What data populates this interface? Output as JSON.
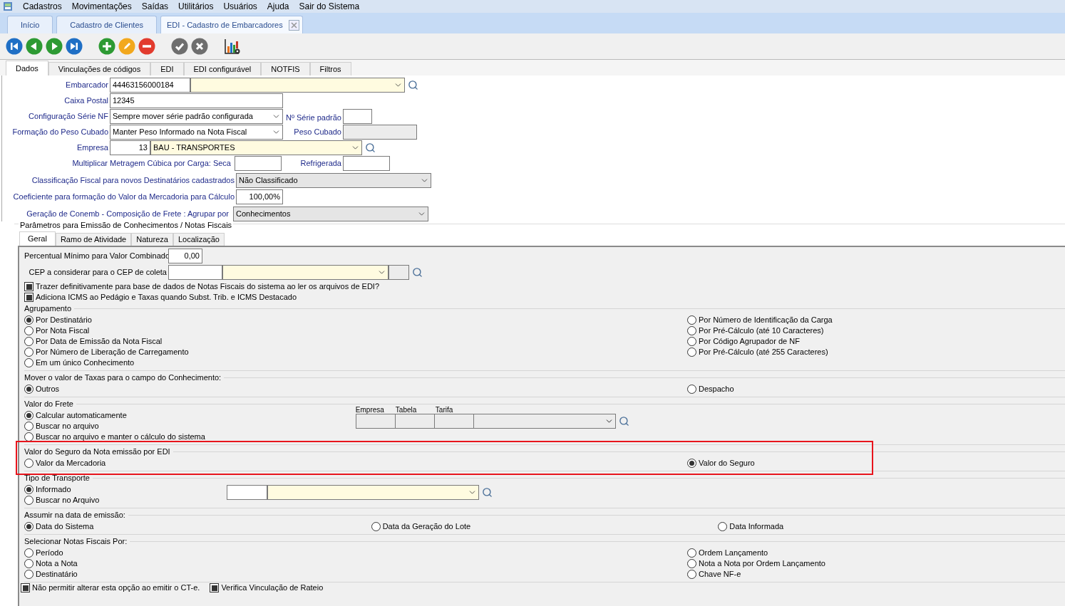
{
  "menu": [
    "Cadastros",
    "Movimentações",
    "Saídas",
    "Utilitários",
    "Usuários",
    "Ajuda",
    "Sair do Sistema"
  ],
  "doc_tabs": [
    {
      "label": "Início",
      "selected": false,
      "closable": false
    },
    {
      "label": "Cadastro de Clientes",
      "selected": false,
      "closable": false
    },
    {
      "label": "EDI - Cadastro de Embarcadores",
      "selected": true,
      "closable": true
    }
  ],
  "toolbar": [
    {
      "kind": "first",
      "disabled": false
    },
    {
      "kind": "prev",
      "disabled": false
    },
    {
      "kind": "next",
      "disabled": false
    },
    {
      "kind": "last",
      "disabled": false
    },
    {
      "kind": "add",
      "disabled": false
    },
    {
      "kind": "edit",
      "disabled": false
    },
    {
      "kind": "delete",
      "disabled": false
    },
    {
      "kind": "confirm",
      "disabled": true
    },
    {
      "kind": "cancel",
      "disabled": true
    },
    {
      "kind": "report",
      "disabled": false
    }
  ],
  "tabs": [
    {
      "label": "Dados",
      "selected": true
    },
    {
      "label": "Vinculações de códigos",
      "selected": false
    },
    {
      "label": "EDI",
      "selected": false
    },
    {
      "label": "EDI configurável",
      "selected": false
    },
    {
      "label": "NOTFIS",
      "selected": false
    },
    {
      "label": "Filtros",
      "selected": false
    }
  ],
  "form": {
    "embarcador": {
      "label": "Embarcador",
      "code": "44463156000184"
    },
    "caixa_postal": {
      "label": "Caixa Postal",
      "value": "12345"
    },
    "serie_nf": {
      "label": "Configuração Série NF",
      "value": "Sempre mover série padrão configurada"
    },
    "serie_padrao": {
      "label": "Nº Série padrão"
    },
    "peso_formacao": {
      "label": "Formação do Peso Cubado",
      "value": "Manter Peso Informado na Nota Fiscal"
    },
    "peso_cubado": {
      "label": "Peso Cubado",
      "disabled": true
    },
    "empresa": {
      "label": "Empresa",
      "code": "13",
      "name": "BAU - TRANSPORTES"
    },
    "metragem_seca": {
      "label": "Multiplicar Metragem Cúbica por Carga: Seca"
    },
    "refrigerada": {
      "label": "Refrigerada"
    },
    "classificacao": {
      "label": "Classificação Fiscal para novos Destinatários cadastrados",
      "value": "Não Classificado"
    },
    "coeficiente": {
      "label": "Coeficiente para formação do Valor da Mercadoria para Cálculo",
      "value": "100,00%"
    },
    "conemb": {
      "label": "Geração de Conemb - Composição de Frete : Agrupar por",
      "value": "Conhecimentos"
    }
  },
  "params": {
    "title": "Parâmetros para Emissão de Conhecimentos / Notas Fiscais",
    "tabs": [
      {
        "label": "Geral",
        "selected": true
      },
      {
        "label": "Ramo de Atividade",
        "selected": false
      },
      {
        "label": "Natureza",
        "selected": false
      },
      {
        "label": "Localização",
        "selected": false
      }
    ],
    "percentual": {
      "label": "Percentual Mínimo para Valor Combinado",
      "value": "0,00"
    },
    "cep": {
      "label": "CEP a considerar para o CEP de coleta"
    },
    "checks": [
      {
        "label": "Trazer definitivamente para base de dados de Notas Fiscais do sistema ao ler os arquivos de EDI?",
        "checked": true
      },
      {
        "label": "Adiciona ICMS ao Pedágio e Taxas quando Subst. Trib. e ICMS Destacado",
        "checked": true
      }
    ],
    "groups": [
      {
        "title": "Agrupamento",
        "kind": "options",
        "highlighted": false,
        "columns": [
          [
            {
              "label": "Por Destinatário",
              "selected": true
            },
            {
              "label": "Por Nota Fiscal",
              "selected": false
            },
            {
              "label": "Por Data de Emissão da Nota Fiscal",
              "selected": false
            },
            {
              "label": "Por Número de Liberação de Carregamento",
              "selected": false
            },
            {
              "label": "Em um único Conhecimento",
              "selected": false
            }
          ],
          [
            {
              "label": "Por Número de Identificação da Carga",
              "selected": false
            },
            {
              "label": "Por Pré-Cálculo (até 10 Caracteres)",
              "selected": false
            },
            {
              "label": "Por Código Agrupador de NF",
              "selected": false
            },
            {
              "label": "Por Pré-Cálculo (até 255 Caracteres)",
              "selected": false
            }
          ]
        ]
      },
      {
        "title": "Mover o valor de Taxas para o campo do Conhecimento:",
        "kind": "options",
        "highlighted": false,
        "columns": [
          [
            {
              "label": "Outros",
              "selected": true
            }
          ],
          [
            {
              "label": "Despacho",
              "selected": false
            }
          ]
        ]
      },
      {
        "title": "Valor do Frete",
        "kind": "table_lookup",
        "highlighted": false,
        "headers": [
          "Empresa",
          "Tabela",
          "Tarifa"
        ],
        "columns": [
          [
            {
              "label": "Calcular automaticamente",
              "selected": true
            },
            {
              "label": "Buscar no arquivo",
              "selected": false
            },
            {
              "label": "Buscar no arquivo e manter o cálculo do sistema",
              "selected": false
            }
          ]
        ]
      },
      {
        "title": "Valor do Seguro da Nota emissão por EDI",
        "kind": "options",
        "highlighted": true,
        "columns": [
          [
            {
              "label": "Valor da Mercadoria",
              "selected": false
            }
          ],
          [
            {
              "label": "Valor do Seguro",
              "selected": true
            }
          ]
        ]
      },
      {
        "title": "Tipo de Transporte",
        "kind": "lookup",
        "highlighted": false,
        "columns": [
          [
            {
              "label": "Informado",
              "selected": true
            },
            {
              "label": "Buscar no Arquivo",
              "selected": false
            }
          ]
        ]
      },
      {
        "title": "Assumir na data de emissão:",
        "kind": "options",
        "highlighted": false,
        "columns": [
          [
            {
              "label": "Data do Sistema",
              "selected": true
            }
          ],
          [
            {
              "label": "Data da Geração do Lote",
              "selected": false
            }
          ],
          [
            {
              "label": "Data Informada",
              "selected": false
            }
          ]
        ]
      },
      {
        "title": "Selecionar Notas Fiscais Por:",
        "kind": "options",
        "highlighted": false,
        "columns": [
          [
            {
              "label": "Período",
              "selected": false
            },
            {
              "label": "Nota a Nota",
              "selected": false
            },
            {
              "label": "Destinatário",
              "selected": false
            }
          ],
          [
            {
              "label": "Ordem Lançamento",
              "selected": false
            },
            {
              "label": "Nota a Nota por Ordem Lançamento",
              "selected": false
            },
            {
              "label": "Chave NF-e",
              "selected": false
            }
          ]
        ]
      }
    ],
    "bottom_checks": [
      {
        "label": "Não permitir alterar esta opção ao emitir o CT-e.",
        "checked": true
      },
      {
        "label": "Verifica Vinculação de Rateio",
        "checked": true
      }
    ]
  }
}
